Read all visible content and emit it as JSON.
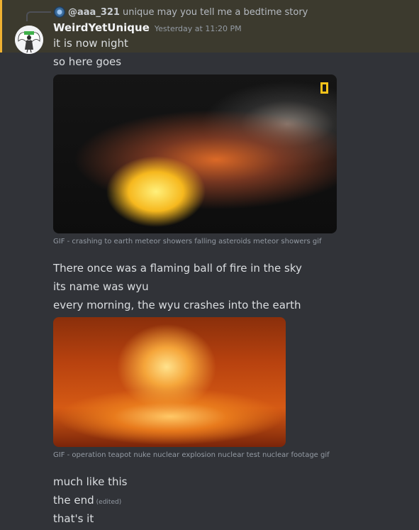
{
  "reply": {
    "username": "@aaa_321",
    "text": "unique may you tell me a bedtime story"
  },
  "message": {
    "author": "WeirdYetUnique",
    "timestamp": "Yesterday at 11:20 PM",
    "lines": [
      "it is now night",
      "so here goes",
      "There once was a flaming ball of fire in the sky",
      "its name was wyu",
      "every morning, the wyu crashes into the earth",
      "much like this",
      "the end",
      "that's it"
    ],
    "edited_label": "(edited)"
  },
  "gifs": [
    {
      "caption": "GIF - crashing to earth meteor showers falling asteroids meteor showers gif"
    },
    {
      "caption": "GIF - operation teapot nuke nuclear explosion nuclear test nuclear footage gif"
    }
  ],
  "colors": {
    "highlight_bar": "#f0b232",
    "background": "#313338",
    "username": "#f2f3f5"
  }
}
